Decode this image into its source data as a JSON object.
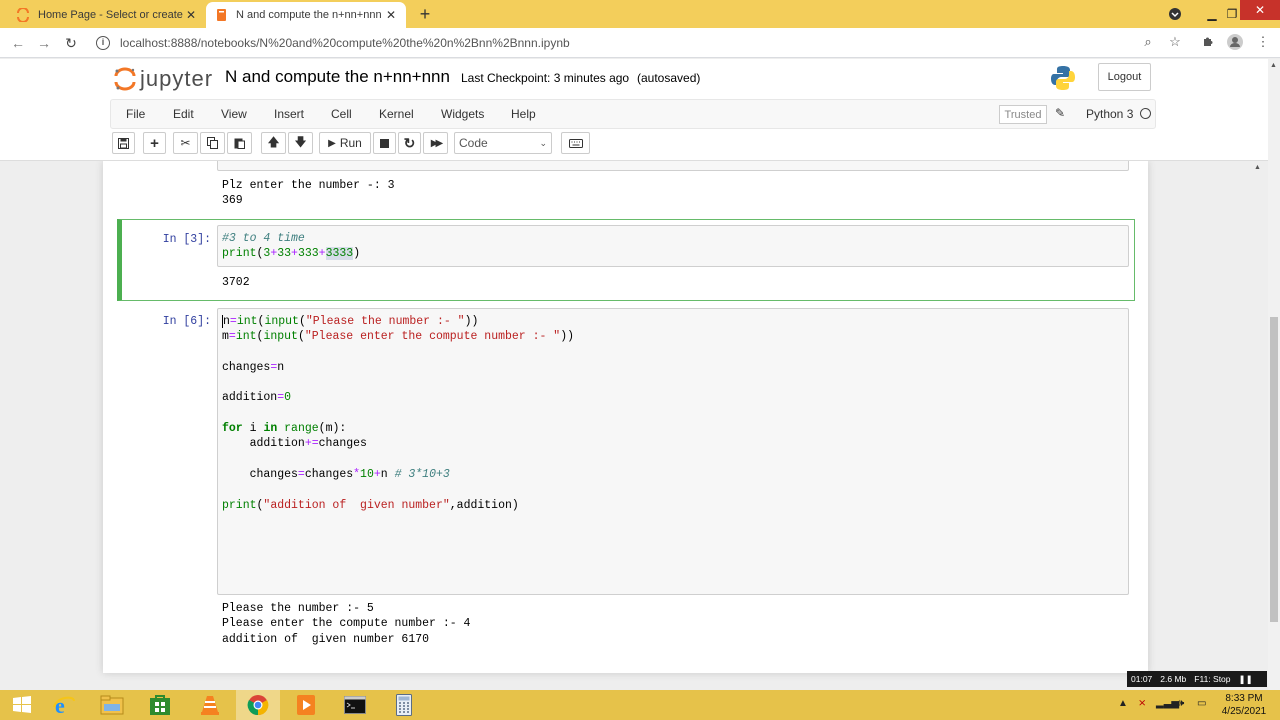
{
  "browser": {
    "tabs": [
      {
        "title": "Home Page - Select or create a n",
        "active": false
      },
      {
        "title": "N and compute the n+nn+nnn -",
        "active": true
      }
    ],
    "url": "localhost:8888/notebooks/N%20and%20compute%20the%20n%2Bnn%2Bnnn.ipynb",
    "tab_close": "✕",
    "new_tab": "+"
  },
  "jupyter": {
    "logo_text": "jupyter",
    "notebook_name": "N and compute the n+nn+nnn",
    "checkpoint": "Last Checkpoint: 3 minutes ago",
    "autosave": "(autosaved)",
    "logout_label": "Logout",
    "menu": [
      "File",
      "Edit",
      "View",
      "Insert",
      "Cell",
      "Kernel",
      "Widgets",
      "Help"
    ],
    "trusted_label": "Trusted",
    "kernel_name": "Python 3",
    "toolbar": {
      "run_label": "Run",
      "cell_type": "Code"
    }
  },
  "cells": {
    "prev_output": [
      "Plz enter the number -: 3",
      "369"
    ],
    "cell3": {
      "prompt": "In [3]:",
      "output": "3702"
    },
    "cell6": {
      "prompt": "In [6]:",
      "output": [
        "Please the number :- 5",
        "Please enter the compute number :- 4",
        "addition of  given number 6170"
      ]
    }
  },
  "taskbar": {
    "time": "8:33 PM",
    "date": "4/25/2021",
    "recorder": [
      "01:07",
      "2.6 Mb",
      "F11: Stop"
    ]
  },
  "colors": {
    "accent_green": "#4caf50",
    "prompt_blue": "#303f9f",
    "taskbar": "#e6c24a"
  }
}
